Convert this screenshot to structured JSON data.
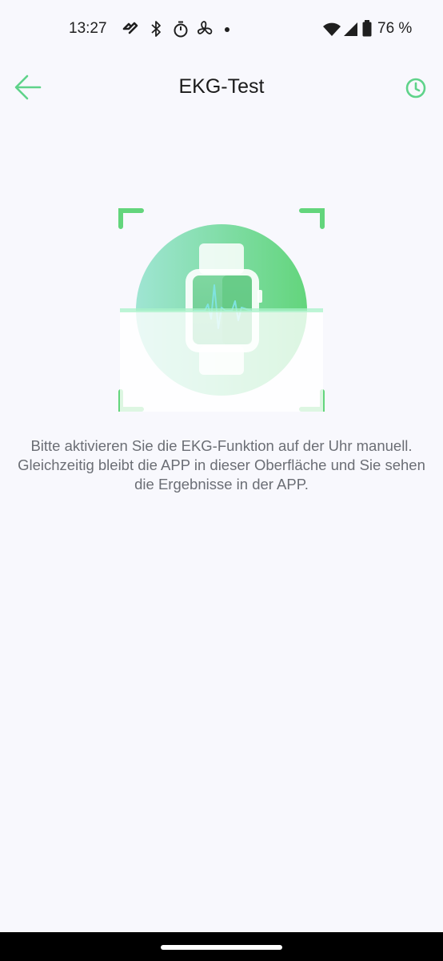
{
  "status_bar": {
    "time": "13:27",
    "left_icons": [
      "fitness-app-icon",
      "bluetooth-icon",
      "stopwatch-icon",
      "fan-icon",
      "dot-icon"
    ],
    "right_icons": [
      "wifi-icon",
      "signal-icon",
      "battery-icon"
    ],
    "battery_percent": "76 %"
  },
  "header": {
    "title": "EKG-Test",
    "back_icon": "arrow-left-icon",
    "history_icon": "clock-icon"
  },
  "illustration": {
    "icon": "watch-ecg-icon",
    "accent_color": "#5fd38a"
  },
  "instruction": "Bitte aktivieren Sie die EKG-Funktion auf der Uhr manuell. Gleichzeitig bleibt die APP in dieser Oberfläche und Sie sehen die Ergebnisse in der APP.",
  "colors": {
    "background": "#f8f8fd",
    "accent": "#5fd38a",
    "text_muted": "#6b6e75"
  }
}
